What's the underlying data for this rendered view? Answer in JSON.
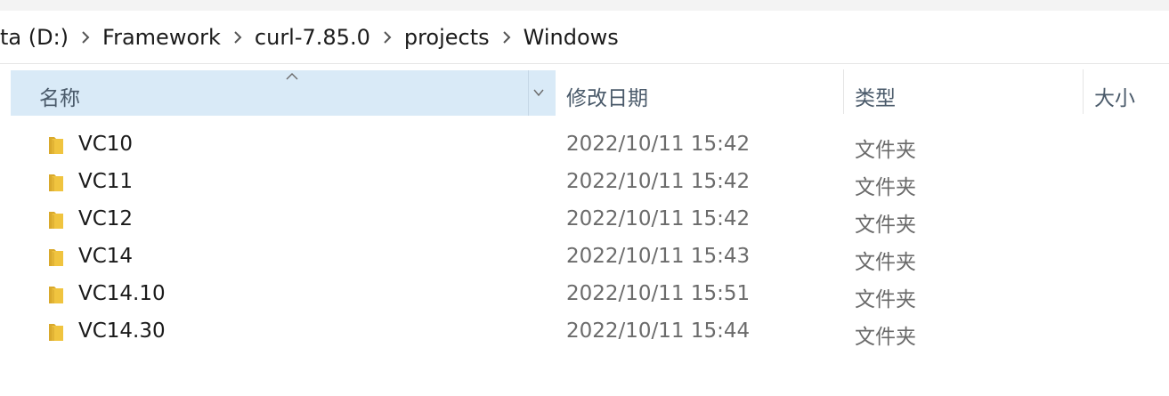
{
  "breadcrumb": {
    "items": [
      "ta (D:)",
      "Framework",
      "curl-7.85.0",
      "projects",
      "Windows"
    ]
  },
  "columns": {
    "name": "名称",
    "date_modified": "修改日期",
    "type": "类型",
    "size": "大小"
  },
  "sort": {
    "column": "name",
    "direction": "ascending"
  },
  "files": [
    {
      "name": "VC10",
      "date": "2022/10/11 15:42",
      "type": "文件夹",
      "icon": "folder-icon"
    },
    {
      "name": "VC11",
      "date": "2022/10/11 15:42",
      "type": "文件夹",
      "icon": "folder-icon"
    },
    {
      "name": "VC12",
      "date": "2022/10/11 15:42",
      "type": "文件夹",
      "icon": "folder-icon"
    },
    {
      "name": "VC14",
      "date": "2022/10/11 15:43",
      "type": "文件夹",
      "icon": "folder-icon"
    },
    {
      "name": "VC14.10",
      "date": "2022/10/11 15:51",
      "type": "文件夹",
      "icon": "folder-icon"
    },
    {
      "name": "VC14.30",
      "date": "2022/10/11 15:44",
      "type": "文件夹",
      "icon": "folder-icon"
    }
  ],
  "colors": {
    "selected_header": "#d9eaf7",
    "folder": "#f0c43f"
  }
}
